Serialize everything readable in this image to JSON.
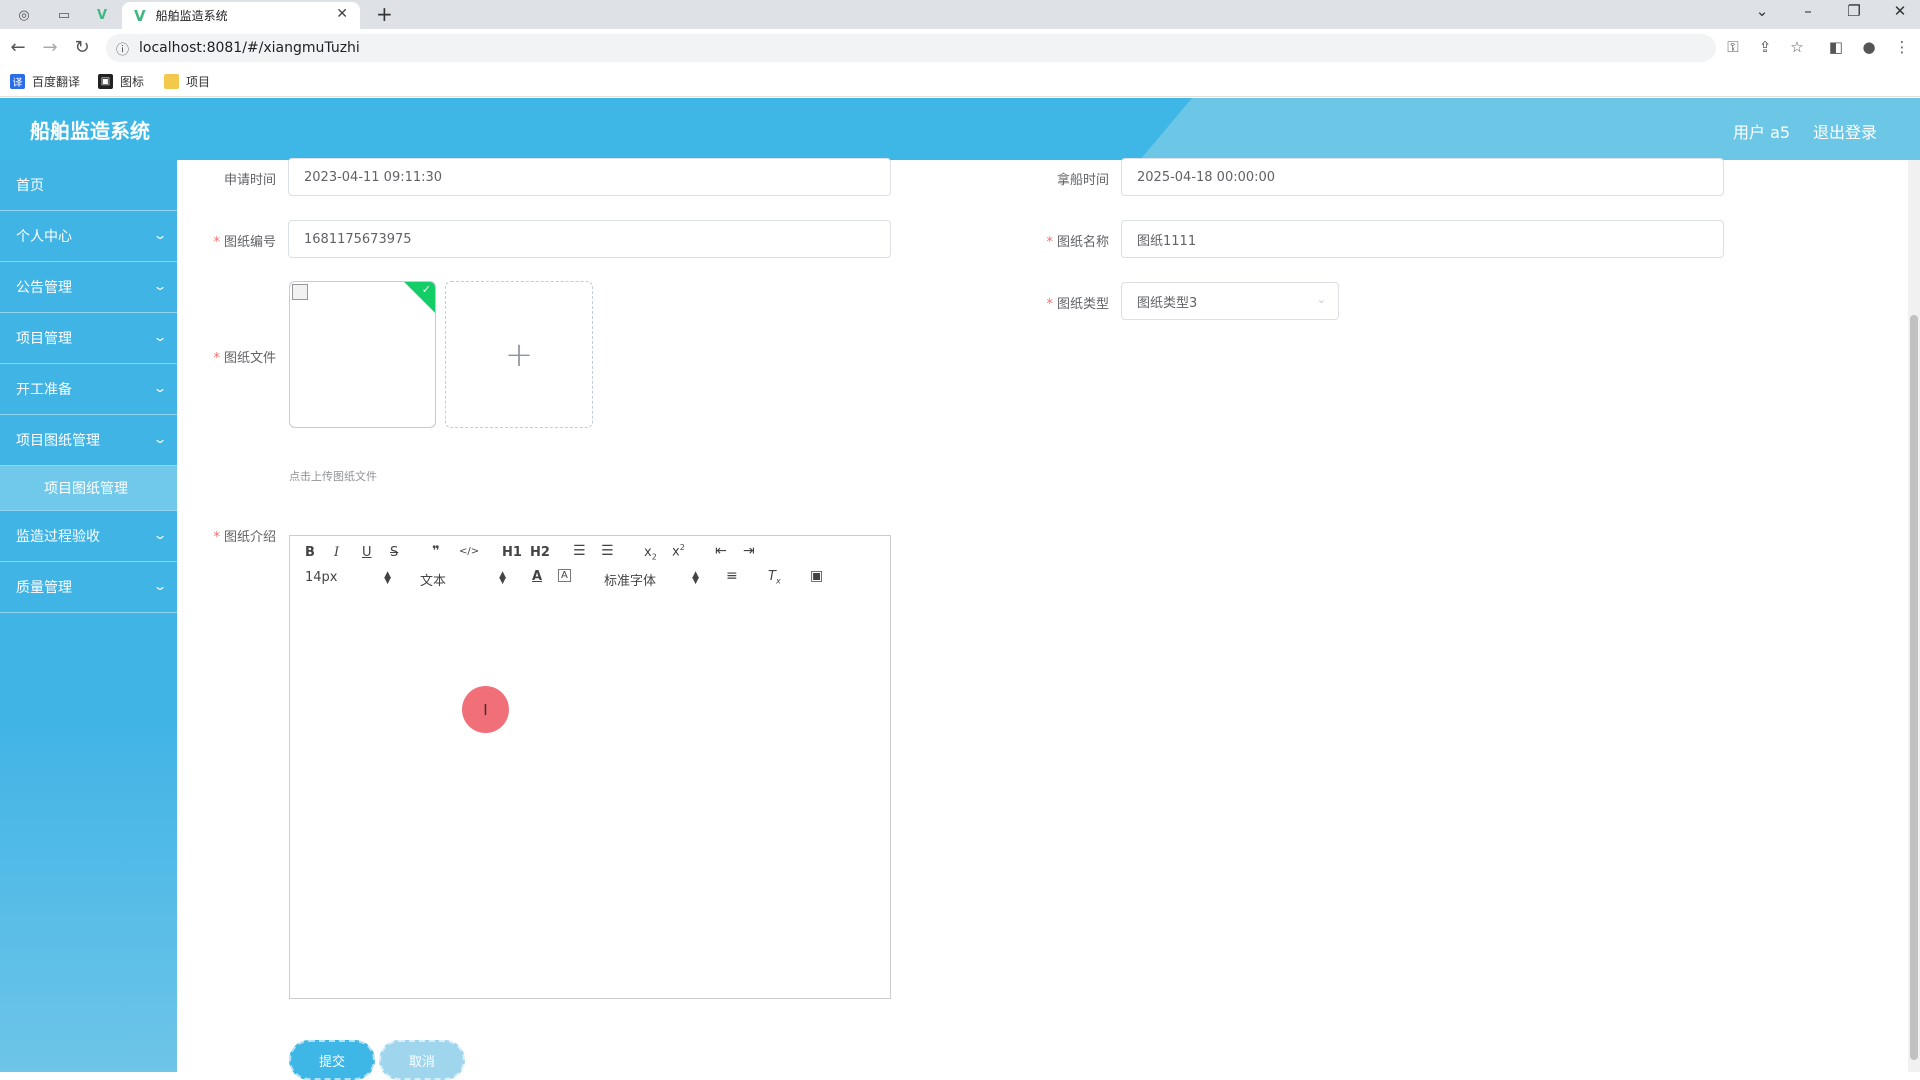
{
  "browser": {
    "tab_title": "船舶监造系统",
    "url": "localhost:8081/#/xiangmuTuzhi",
    "bookmarks": [
      "百度翻译",
      "图标",
      "项目"
    ]
  },
  "header": {
    "title": "船舶监造系统",
    "user": "用户 a5",
    "logout": "退出登录"
  },
  "sidebar": {
    "items": [
      {
        "label": "首页"
      },
      {
        "label": "个人中心"
      },
      {
        "label": "公告管理"
      },
      {
        "label": "项目管理"
      },
      {
        "label": "开工准备"
      },
      {
        "label": "项目图纸管理"
      },
      {
        "label": "监造过程验收"
      },
      {
        "label": "质量管理"
      }
    ],
    "submenu": {
      "label": "项目图纸管理"
    }
  },
  "form": {
    "apply_time": {
      "label": "申请时间",
      "value": "2023-04-11 09:11:30"
    },
    "ship_time": {
      "label": "拿船时间",
      "value": "2025-04-18 00:00:00"
    },
    "drawing_no": {
      "label": "图纸编号",
      "value": "1681175673975"
    },
    "drawing_name": {
      "label": "图纸名称",
      "value": "图纸1111"
    },
    "drawing_type": {
      "label": "图纸类型",
      "value": "图纸类型3"
    },
    "drawing_file": {
      "label": "图纸文件",
      "hint": "点击上传图纸文件",
      "add_icon": "+"
    },
    "drawing_intro": {
      "label": "图纸介绍"
    },
    "required_mark": "*"
  },
  "editor": {
    "font_size": "14px",
    "paragraph": "文本",
    "font_family": "标准字体",
    "buttons": [
      "B",
      "I",
      "U",
      "S",
      "❞",
      "</>",
      "H1",
      "H2",
      "ordered-list",
      "bullet-list",
      "x2",
      "x2",
      "outdent",
      "indent",
      "A",
      "A",
      "align",
      "Tx",
      "image"
    ]
  },
  "actions": {
    "submit": "提交",
    "cancel": "取消"
  },
  "colors": {
    "header": "#3fb7e6",
    "sidebar": "#41b4e6",
    "required": "#f56c6c",
    "success_badge": "#13ce66",
    "submit": "#3fb7e6",
    "cancel": "#9fd6ee"
  }
}
